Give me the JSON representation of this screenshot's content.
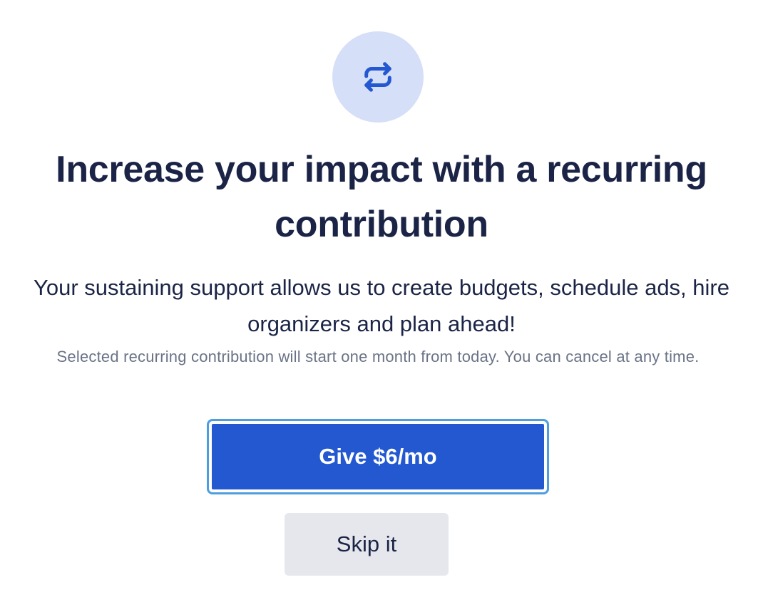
{
  "icon": {
    "name": "recurring-arrows-icon",
    "color": "#2358d1",
    "background": "#d5dff7"
  },
  "headline": "Increase your impact with a recurring contribution",
  "subhead": "Your sustaining support allows us to create budgets, schedule ads, hire organizers and plan ahead!",
  "note": "Selected recurring contribution will start one month from today. You can cancel at any time.",
  "primary_button": {
    "label": "Give $6/mo",
    "color": "#2358d1"
  },
  "secondary_button": {
    "label": "Skip it",
    "color": "#e6e7ec"
  },
  "colors": {
    "text_primary": "#1b2446",
    "text_muted": "#6a7386",
    "focus_ring": "#4d9ee0"
  }
}
